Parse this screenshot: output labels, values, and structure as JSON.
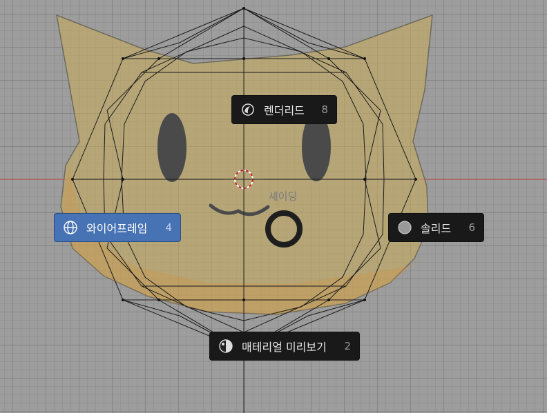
{
  "pie_menu": {
    "title": "셰이딩",
    "items": [
      {
        "label": "렌더리드",
        "key": "8",
        "icon": "rendered-sphere-icon"
      },
      {
        "label": "와이어프레임",
        "key": "4",
        "icon": "wireframe-globe-icon",
        "active": true
      },
      {
        "label": "솔리드",
        "key": "6",
        "icon": "solid-sphere-icon"
      },
      {
        "label": "매테리얼 미리보기",
        "key": "2",
        "icon": "material-preview-icon"
      }
    ]
  },
  "colors": {
    "viewport_bg": "#9d9d9d",
    "active_item": "#4772b3",
    "menu_item": "#191919",
    "x_axis": "#d24c4c",
    "face_fill": "#c8b06a"
  }
}
